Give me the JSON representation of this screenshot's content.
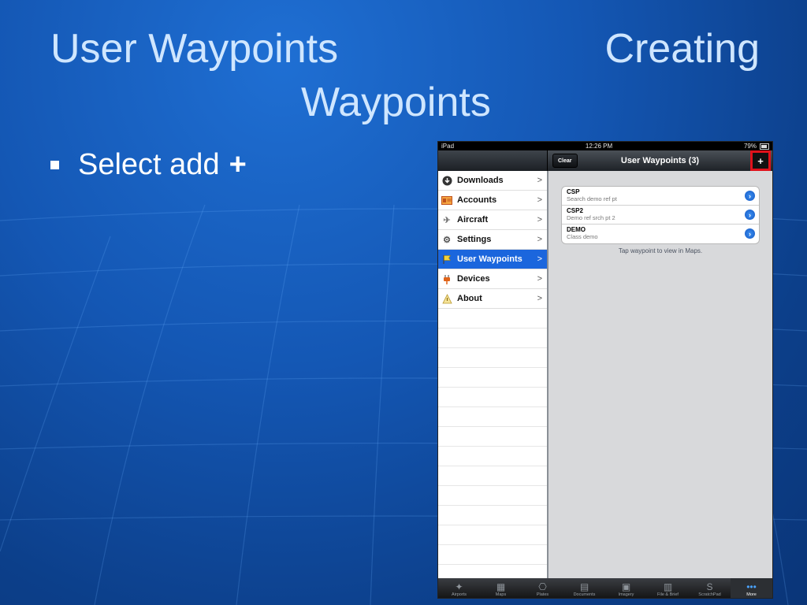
{
  "slide": {
    "title_left": "User Waypoints",
    "title_right": "Creating",
    "title_line2": "Waypoints",
    "bullet_text": "Select add",
    "bullet_plus": "+"
  },
  "ipad": {
    "status": {
      "device": "iPad",
      "time": "12:26 PM",
      "battery": "79%"
    },
    "nav": {
      "clear_label": "Clear",
      "title": "User Waypoints (3)",
      "add_label": "+"
    },
    "sidebar": {
      "items": [
        {
          "label": "Downloads",
          "icon": "download-icon"
        },
        {
          "label": "Accounts",
          "icon": "id-card-icon"
        },
        {
          "label": "Aircraft",
          "icon": "airplane-icon"
        },
        {
          "label": "Settings",
          "icon": "gear-icon"
        },
        {
          "label": "User Waypoints",
          "icon": "flag-icon",
          "active": true
        },
        {
          "label": "Devices",
          "icon": "plug-icon"
        },
        {
          "label": "About",
          "icon": "info-icon"
        }
      ]
    },
    "waypoints": [
      {
        "name": "CSP",
        "desc": "Search demo ref pt"
      },
      {
        "name": "CSP2",
        "desc": "Demo ref srch pt 2"
      },
      {
        "name": "DEMO",
        "desc": "Class demo"
      }
    ],
    "hint": "Tap waypoint to view in Maps.",
    "tabs": [
      {
        "label": "Airports",
        "icon": "airport-icon"
      },
      {
        "label": "Maps",
        "icon": "map-icon"
      },
      {
        "label": "Plates",
        "icon": "plates-icon"
      },
      {
        "label": "Documents",
        "icon": "documents-icon"
      },
      {
        "label": "Imagery",
        "icon": "imagery-icon"
      },
      {
        "label": "File & Brief",
        "icon": "file-brief-icon"
      },
      {
        "label": "ScratchPad",
        "icon": "scratchpad-icon"
      },
      {
        "label": "More",
        "icon": "more-icon",
        "active": true
      }
    ],
    "colors": {
      "accent": "#1b66dd",
      "highlight_box": "#e0121b"
    }
  }
}
